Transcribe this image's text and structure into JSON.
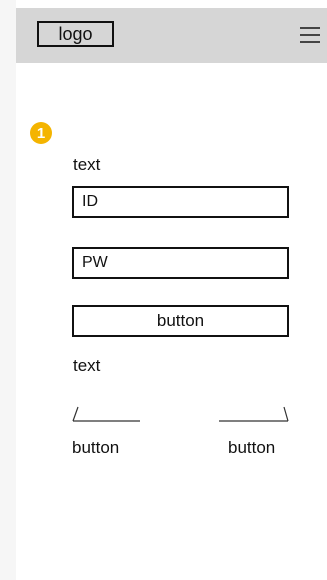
{
  "header": {
    "logo_text": "logo",
    "menu_icon": "hamburger-menu-icon"
  },
  "step_badge": "1",
  "login": {
    "top_text": "text",
    "id_value": "ID",
    "pw_value": "PW",
    "submit_label": "button",
    "bottom_text": "text"
  },
  "footer_links": {
    "left_label": "button",
    "right_label": "button"
  },
  "colors": {
    "header_bg": "#d6d6d6",
    "badge": "#f4b400",
    "outline": "#111111"
  }
}
